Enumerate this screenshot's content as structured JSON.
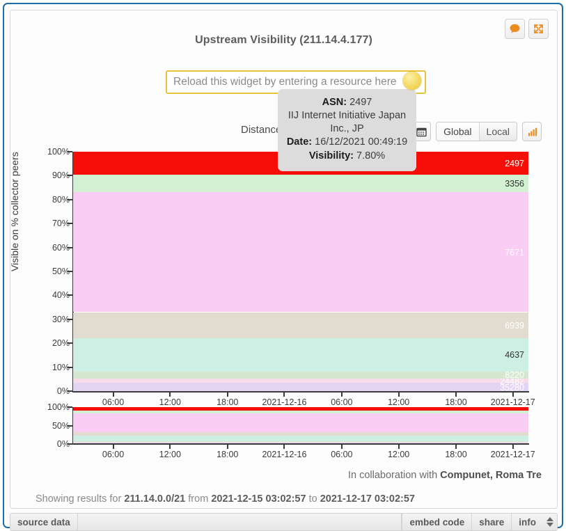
{
  "widget": {
    "title": "Upstream Visibility (211.14.4.177)",
    "corner_buttons": [
      {
        "name": "feedback-icon",
        "label": "feedback"
      },
      {
        "name": "expand-icon",
        "label": "expand"
      }
    ]
  },
  "resource_input": {
    "placeholder": "Reload this widget by entering a resource here",
    "value": ""
  },
  "toolbar": {
    "distance_label": "Distance",
    "calendar_label": "calendar",
    "scope_options": [
      "Global",
      "Local"
    ],
    "scope_selected": "Global",
    "chart_toggle_label": "chart"
  },
  "tooltip": {
    "asn_label": "ASN:",
    "asn_value": "2497",
    "holder": "IIJ Internet Initiative Japan Inc., JP",
    "date_label": "Date:",
    "date_value": "16/12/2021 00:49:19",
    "visibility_label": "Visibility:",
    "visibility_value": "7.80%"
  },
  "footer": {
    "source_data": "source data",
    "embed_code": "embed code",
    "share": "share",
    "info": "info"
  },
  "collaboration": {
    "prefix": "In collaboration with ",
    "partner": "Compunet, Roma Tre"
  },
  "results": {
    "prefix": "Showing results for ",
    "resource": "211.14.0.0/21",
    "from_word": " from ",
    "from": "2021-12-15 03:02:57",
    "to_word": " to ",
    "to": "2021-12-17 03:02:57"
  },
  "chart_data": {
    "type": "area",
    "title": "Upstream Visibility (211.14.4.177)",
    "xlabel": "",
    "ylabel": "Visible on % collector peers",
    "ylim": [
      0,
      100
    ],
    "grid": false,
    "legend": "inline-right-labels",
    "ytick_labels": [
      "0%",
      "10%",
      "20%",
      "30%",
      "40%",
      "50%",
      "60%",
      "70%",
      "80%",
      "90%",
      "100%"
    ],
    "ytick_values": [
      0,
      10,
      20,
      30,
      40,
      50,
      60,
      70,
      80,
      90,
      100
    ],
    "xtick_labels": [
      "06:00",
      "12:00",
      "18:00",
      "2021-12-16",
      "06:00",
      "12:00",
      "18:00",
      "2021-12-17"
    ],
    "xtick_positions_pct": [
      8.8,
      21.3,
      33.9,
      46.4,
      59.0,
      71.5,
      84.1,
      96.6
    ],
    "stack_order_bottom_to_top": [
      {
        "asn": "35280",
        "value": 3.4,
        "color": "#e2d4f2",
        "label_color": "#ffffff"
      },
      {
        "asn": "24482",
        "value": 1.8,
        "color": "#f9dce9",
        "label_color": "#ffffff"
      },
      {
        "asn": "8220",
        "value": 3.0,
        "color": "#d5e8cf",
        "label_color": "#ffffff"
      },
      {
        "asn": "4637",
        "value": 14.0,
        "color": "#cdefe4",
        "label_color": "#333333"
      },
      {
        "asn": "6939",
        "value": 10.8,
        "color": "#e2dcd0",
        "label_color": "#ffffff"
      },
      {
        "asn": "7671",
        "value": 50.0,
        "color": "#f9cdf4",
        "label_color": "#ffffff"
      },
      {
        "asn": "3356",
        "value": 7.4,
        "color": "#d2f0d2",
        "label_color": "#333333"
      },
      {
        "asn": "2497",
        "value": 9.6,
        "color": "#f70d07",
        "label_color": "#ffffff"
      }
    ],
    "brush": {
      "ytick_labels": [
        "0%",
        "50%",
        "100%"
      ],
      "ytick_values": [
        0,
        50,
        100
      ],
      "xtick_labels": [
        "06:00",
        "12:00",
        "18:00",
        "2021-12-16",
        "06:00",
        "12:00",
        "18:00",
        "2021-12-17"
      ]
    }
  },
  "colors": {
    "frame_border": "#1b6ca8",
    "accent_orange": "#eb8c1e",
    "input_border": "#e8c23a",
    "top_band_red": "#f70d07"
  }
}
